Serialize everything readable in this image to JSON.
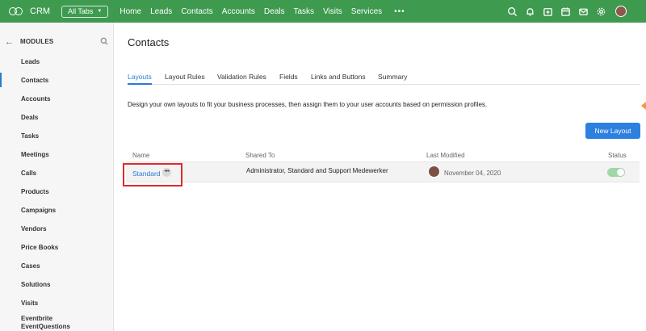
{
  "topbar": {
    "app_name": "CRM",
    "all_tabs_label": "All Tabs",
    "nav": [
      "Home",
      "Leads",
      "Contacts",
      "Accounts",
      "Deals",
      "Tasks",
      "Visits",
      "Services"
    ],
    "more_label": "•••",
    "bar_color": "#3e9a4f",
    "icons": [
      "search-icon",
      "bell-icon",
      "calendar-add-icon",
      "calendar-icon",
      "mail-icon",
      "gear-icon"
    ]
  },
  "sidebar": {
    "back_label": "←",
    "title": "MODULES",
    "items": [
      {
        "label": "Leads"
      },
      {
        "label": "Contacts",
        "active": true
      },
      {
        "label": "Accounts"
      },
      {
        "label": "Deals"
      },
      {
        "label": "Tasks"
      },
      {
        "label": "Meetings"
      },
      {
        "label": "Calls"
      },
      {
        "label": "Products"
      },
      {
        "label": "Campaigns"
      },
      {
        "label": "Vendors"
      },
      {
        "label": "Price Books"
      },
      {
        "label": "Cases"
      },
      {
        "label": "Solutions"
      },
      {
        "label": "Visits"
      },
      {
        "label": "Eventbrite\nEventQuestions"
      }
    ]
  },
  "main": {
    "title": "Contacts",
    "tabs": [
      "Layouts",
      "Layout Rules",
      "Validation Rules",
      "Fields",
      "Links and Buttons",
      "Summary"
    ],
    "active_tab": "Layouts",
    "description": "Design your own layouts to fit your business processes, then assign them to your user accounts based on permission profiles.",
    "new_button": "New Layout",
    "accent_color": "#2b7ad6",
    "table": {
      "headers": [
        "Name",
        "Shared To",
        "Last Modified",
        "Status"
      ],
      "rows": [
        {
          "name": "Standard",
          "more": "•••",
          "shared_to": "Administrator, Standard and Support Medewerker",
          "last_modified": "November 04, 2020",
          "status_enabled": true
        }
      ]
    }
  }
}
